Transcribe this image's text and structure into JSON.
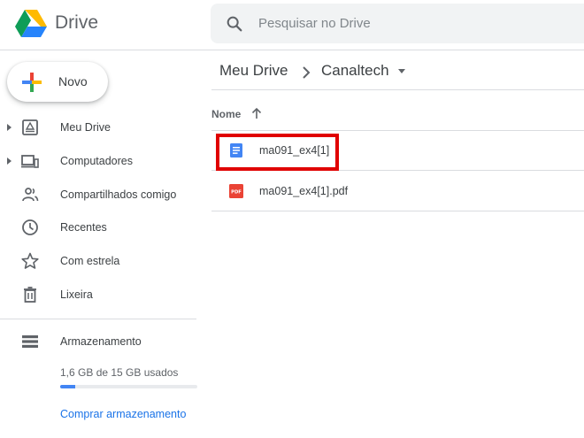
{
  "app": {
    "name": "Drive"
  },
  "search": {
    "placeholder": "Pesquisar no Drive"
  },
  "new_button": {
    "label": "Novo"
  },
  "sidebar": {
    "items": [
      {
        "label": "Meu Drive",
        "icon": "my-drive-icon",
        "expandable": true
      },
      {
        "label": "Computadores",
        "icon": "computers-icon",
        "expandable": true
      },
      {
        "label": "Compartilhados comigo",
        "icon": "shared-icon",
        "expandable": false
      },
      {
        "label": "Recentes",
        "icon": "clock-icon",
        "expandable": false
      },
      {
        "label": "Com estrela",
        "icon": "star-icon",
        "expandable": false
      },
      {
        "label": "Lixeira",
        "icon": "trash-icon",
        "expandable": false
      }
    ],
    "storage": {
      "label": "Armazenamento",
      "usage": "1,6 GB de 15 GB usados",
      "used_fraction": 0.107,
      "buy_label": "Comprar armazenamento"
    }
  },
  "breadcrumb": {
    "root": "Meu Drive",
    "current": "Canaltech"
  },
  "file_list": {
    "column_name": "Nome",
    "files": [
      {
        "name": "ma091_ex4[1]",
        "type": "google-doc-icon",
        "highlighted": true
      },
      {
        "name": "ma091_ex4[1].pdf",
        "type": "pdf-icon",
        "highlighted": false
      }
    ]
  },
  "colors": {
    "accent": "#1a73e8",
    "doc_blue": "#4285f4",
    "pdf_red": "#ea4335",
    "highlight_red": "#e00000",
    "storage_fill": "#4285f4"
  }
}
